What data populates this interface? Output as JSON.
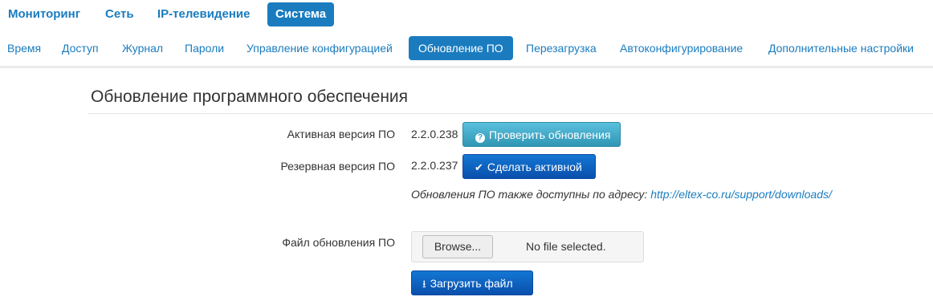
{
  "topnav": {
    "items": [
      {
        "label": "Мониторинг"
      },
      {
        "label": "Сеть"
      },
      {
        "label": "IP-телевидение"
      },
      {
        "label": "Система",
        "active": true
      }
    ]
  },
  "subnav": {
    "items": [
      {
        "label": "Время"
      },
      {
        "label": "Доступ"
      },
      {
        "label": "Журнал"
      },
      {
        "label": "Пароли"
      },
      {
        "label": "Управление конфигурацией"
      },
      {
        "label": "Обновление ПО",
        "active": true
      },
      {
        "label": "Перезагрузка"
      },
      {
        "label": "Автоконфигурирование"
      },
      {
        "label": "Дополнительные настройки"
      }
    ]
  },
  "section": {
    "title": "Обновление программного обеспечения"
  },
  "firmware": {
    "active_label": "Активная версия ПО",
    "active_version": "2.2.0.238",
    "check_updates_label": "Проверить обновления",
    "backup_label": "Резервная версия ПО",
    "backup_version": "2.2.0.237",
    "make_active_label": "Сделать активной",
    "note_text": "Обновления ПО также доступны по адресу: ",
    "note_link": "http://eltex-co.ru/support/downloads/",
    "file_label": "Файл обновления ПО",
    "browse_label": "Browse...",
    "file_status": "No file selected.",
    "upload_label": "Загрузить файл"
  },
  "colors": {
    "link": "#1a7cbf",
    "info_button": "#5bc0de",
    "primary_button": "#0a4fad"
  }
}
